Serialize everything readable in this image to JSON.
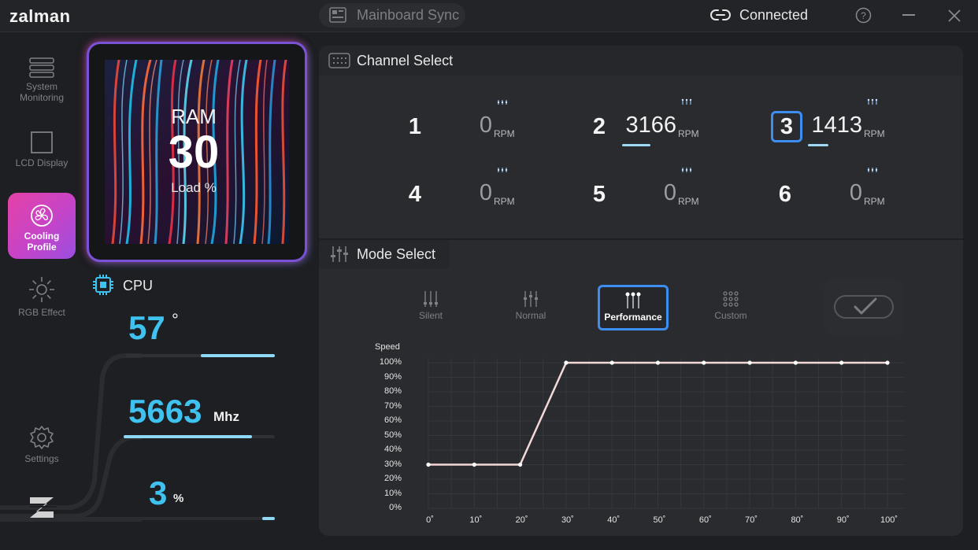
{
  "app": {
    "logo": "zalman"
  },
  "titlebar": {
    "sync_label": "Mainboard Sync",
    "status": "Connected"
  },
  "sidebar": {
    "items": [
      {
        "label": "System Monitoring",
        "icon": "server-icon",
        "active": false
      },
      {
        "label": "LCD Display",
        "icon": "square-icon",
        "active": false
      },
      {
        "label": "Cooling Profile",
        "icon": "fan-icon",
        "active": true
      },
      {
        "label": "RGB Effect",
        "icon": "sun-icon",
        "active": false
      },
      {
        "label": "Settings",
        "icon": "gear-icon",
        "active": false
      }
    ]
  },
  "lcd": {
    "label": "RAM",
    "value": "30",
    "unit": "Load %"
  },
  "cpu": {
    "label": "CPU",
    "temp": {
      "value": "57",
      "unit": "°",
      "level": 0.5
    },
    "clock": {
      "value": "5663",
      "unit": "Mhz",
      "level": 0.85
    },
    "load": {
      "value": "3",
      "unit": "%",
      "level": 0.03
    }
  },
  "channel": {
    "title": "Channel Select",
    "channels": [
      {
        "num": "1",
        "rpm": "0",
        "unit": "RPM",
        "selected": false,
        "spinning": false
      },
      {
        "num": "2",
        "rpm": "3166",
        "unit": "RPM",
        "selected": false,
        "spinning": true
      },
      {
        "num": "3",
        "rpm": "1413",
        "unit": "RPM",
        "selected": true,
        "spinning": true
      },
      {
        "num": "4",
        "rpm": "0",
        "unit": "RPM",
        "selected": false,
        "spinning": false
      },
      {
        "num": "5",
        "rpm": "0",
        "unit": "RPM",
        "selected": false,
        "spinning": false
      },
      {
        "num": "6",
        "rpm": "0",
        "unit": "RPM",
        "selected": false,
        "spinning": false
      }
    ]
  },
  "mode": {
    "title": "Mode Select",
    "modes": [
      {
        "label": "Silent",
        "active": false
      },
      {
        "label": "Normal",
        "active": false
      },
      {
        "label": "Performance",
        "active": true
      },
      {
        "label": "Custom",
        "active": false
      }
    ]
  },
  "colors": {
    "accent": "#3fc2ef",
    "select_border": "#3d8ef0",
    "active_gradient": "#e542a6",
    "curve": "#f4d8d8"
  },
  "chart_data": {
    "type": "line",
    "title": "",
    "xlabel": "",
    "ylabel": "Speed",
    "x": [
      0,
      10,
      20,
      30,
      40,
      50,
      60,
      70,
      80,
      90,
      100
    ],
    "x_ticks": [
      "0˚",
      "10˚",
      "20˚",
      "30˚",
      "40˚",
      "50˚",
      "60˚",
      "70˚",
      "80˚",
      "90˚",
      "100˚"
    ],
    "y_ticks": [
      "0%",
      "10%",
      "20%",
      "30%",
      "40%",
      "50%",
      "60%",
      "70%",
      "80%",
      "90%",
      "100%"
    ],
    "series": [
      {
        "values": [
          30,
          30,
          30,
          100,
          100,
          100,
          100,
          100,
          100,
          100,
          100
        ]
      }
    ],
    "xlim": [
      0,
      100
    ],
    "ylim": [
      0,
      100
    ],
    "grid": true
  }
}
